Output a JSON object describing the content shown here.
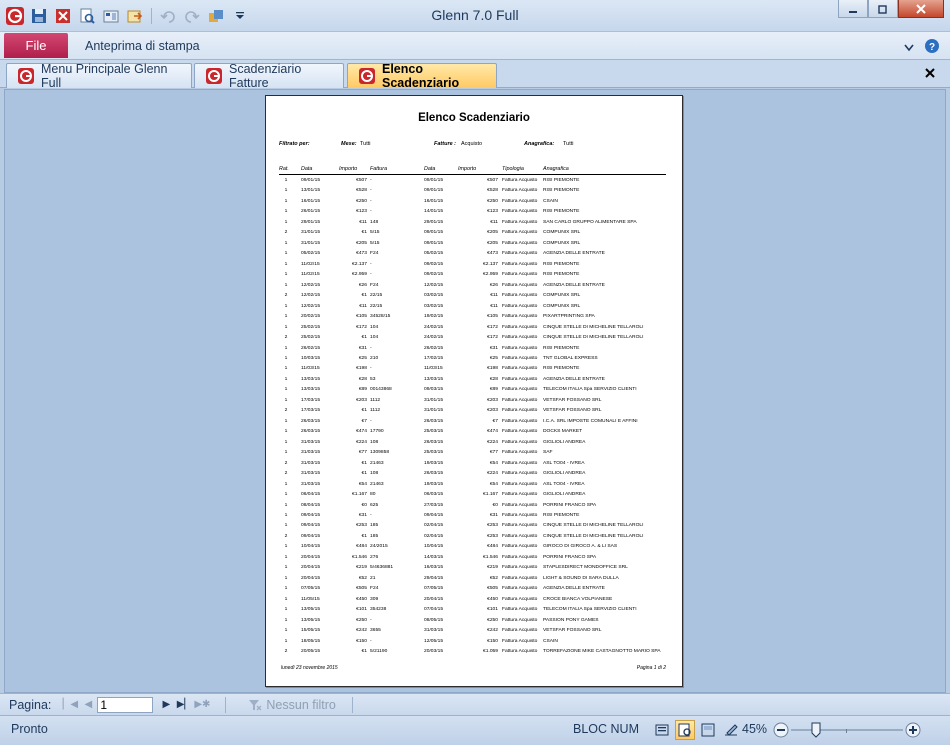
{
  "app": {
    "title": "Glenn 7.0 Full"
  },
  "ribbon": {
    "file_label": "File",
    "active_tab": "Anteprima di stampa"
  },
  "tabs": [
    {
      "label": "Menu Principale Glenn Full"
    },
    {
      "label": "Scadenziario Fatture"
    },
    {
      "label": "Elenco Scadenziario"
    }
  ],
  "report": {
    "title": "Elenco Scadenziario",
    "filters": {
      "label_filtrato": "Filtrato per:",
      "label_mese": "Mese:",
      "mese": "Tutti",
      "label_fatture": "Fatture :",
      "fatture": "Acquisto",
      "label_anagrafica": "Anagrafica:",
      "anagrafica": "Tutti"
    },
    "columns": [
      "Rat.",
      "Data",
      "Importo",
      "Fattura",
      "Data",
      "Importo",
      "Tipologia",
      "Anagrafica"
    ],
    "rows": [
      [
        "1",
        "09/01/15",
        "€507",
        "-",
        "09/01/15",
        "€507",
        "Fattura Acquisto",
        "RISI PIEMONTE"
      ],
      [
        "1",
        "13/01/15",
        "€528",
        "-",
        "09/01/15",
        "€528",
        "Fattura Acquisto",
        "RISI PIEMONTE"
      ],
      [
        "1",
        "16/01/15",
        "€250",
        "-",
        "16/01/15",
        "€250",
        "Fattura Acquisto",
        "CSAIN"
      ],
      [
        "1",
        "26/01/15",
        "€123",
        "-",
        "14/01/15",
        "€123",
        "Fattura Acquisto",
        "RISI PIEMONTE"
      ],
      [
        "1",
        "29/01/15",
        "€11",
        "148",
        "29/01/15",
        "€11",
        "Fattura Acquisto",
        "SAN CARLO GRUPPO ALIMENTARE SPA"
      ],
      [
        "2",
        "31/01/15",
        "€1",
        "5/15",
        "09/01/15",
        "€205",
        "Fattura Acquisto",
        "COMPUNIX SRL"
      ],
      [
        "1",
        "31/01/15",
        "€205",
        "5/15",
        "09/01/15",
        "€205",
        "Fattura Acquisto",
        "COMPUNIX SRL"
      ],
      [
        "1",
        "05/02/15",
        "€473",
        "F24",
        "05/02/15",
        "€473",
        "Fattura Acquisto",
        "AGENZIA DELLE ENTRATE"
      ],
      [
        "1",
        "11/02/15",
        "€2.137",
        "-",
        "09/02/15",
        "€2.137",
        "Fattura Acquisto",
        "RISI PIEMONTE"
      ],
      [
        "1",
        "11/02/15",
        "€2.959",
        "-",
        "09/02/15",
        "€2.959",
        "Fattura Acquisto",
        "RISI PIEMONTE"
      ],
      [
        "1",
        "12/02/15",
        "€26",
        "F24",
        "12/02/15",
        "€26",
        "Fattura Acquisto",
        "AGENZIA DELLE ENTRATE"
      ],
      [
        "2",
        "12/02/15",
        "€1",
        "22/15",
        "03/02/15",
        "€11",
        "Fattura Acquisto",
        "COMPUNIX SRL"
      ],
      [
        "1",
        "12/02/15",
        "€11",
        "22/15",
        "03/02/15",
        "€11",
        "Fattura Acquisto",
        "COMPUNIX SRL"
      ],
      [
        "1",
        "20/02/15",
        "€105",
        "34528/15",
        "19/02/15",
        "€105",
        "Fattura Acquisto",
        "PIXARTPRINTING SPA"
      ],
      [
        "1",
        "25/02/15",
        "€172",
        "104",
        "24/02/15",
        "€172",
        "Fattura Acquisto",
        "CINQUE STELLE DI MICHELINE TELLAROLI"
      ],
      [
        "2",
        "25/02/15",
        "€1",
        "104",
        "24/02/15",
        "€172",
        "Fattura Acquisto",
        "CINQUE STELLE DI MICHELINE TELLAROLI"
      ],
      [
        "1",
        "26/02/15",
        "€31",
        "-",
        "26/02/15",
        "€31",
        "Fattura Acquisto",
        "RISI PIEMONTE"
      ],
      [
        "1",
        "10/03/15",
        "€25",
        "210",
        "17/02/15",
        "€25",
        "Fattura Acquisto",
        "TNT GLOBAL EXPRESS"
      ],
      [
        "1",
        "11/03/15",
        "€198",
        "-",
        "11/03/15",
        "€198",
        "Fattura Acquisto",
        "RISI PIEMONTE"
      ],
      [
        "1",
        "13/03/15",
        "€28",
        "53",
        "13/03/15",
        "€28",
        "Fattura Acquisto",
        "AGENZIA DELLE ENTRATE"
      ],
      [
        "1",
        "13/03/15",
        "€89",
        "00143868",
        "09/03/15",
        "€89",
        "Fattura Acquisto",
        "TELECOM ITALIA Spa SERVIZIO CLIENTI"
      ],
      [
        "1",
        "17/03/15",
        "€203",
        "1112",
        "31/01/15",
        "€203",
        "Fattura Acquisto",
        "VETSFAR FOSSANO SRL"
      ],
      [
        "2",
        "17/03/15",
        "€1",
        "1112",
        "31/01/15",
        "€203",
        "Fattura Acquisto",
        "VETSFAR FOSSANO SRL"
      ],
      [
        "1",
        "26/03/15",
        "€7",
        "-",
        "26/03/15",
        "€7",
        "Fattura Acquisto",
        "I.C.A. SRL IMPOSTE COMUNALI E AFFINI"
      ],
      [
        "1",
        "26/03/15",
        "€474",
        "17790",
        "25/03/15",
        "€474",
        "Fattura Acquisto",
        "DOCKS MARKET"
      ],
      [
        "1",
        "31/03/15",
        "€224",
        "108",
        "26/03/15",
        "€224",
        "Fattura Acquisto",
        "GIGLIOLI ANDREA"
      ],
      [
        "1",
        "31/03/15",
        "€77",
        "1309858",
        "25/03/15",
        "€77",
        "Fattura Acquisto",
        "SAF"
      ],
      [
        "2",
        "31/03/15",
        "€1",
        "21463",
        "19/03/15",
        "€54",
        "Fattura Acquisto",
        "ASL TO04 - IVREA"
      ],
      [
        "2",
        "31/03/15",
        "€1",
        "108",
        "26/03/15",
        "€224",
        "Fattura Acquisto",
        "GIGLIOLI ANDREA"
      ],
      [
        "1",
        "31/03/15",
        "€54",
        "21463",
        "19/03/15",
        "€54",
        "Fattura Acquisto",
        "ASL TO04 - IVREA"
      ],
      [
        "1",
        "06/04/15",
        "€1.167",
        "80",
        "06/03/15",
        "€1.167",
        "Fattura Acquisto",
        "GIGLIOLI ANDREA"
      ],
      [
        "1",
        "08/04/15",
        "€0",
        "625",
        "27/03/15",
        "€0",
        "Fattura Acquisto",
        "PORRINI FRANCO SPA"
      ],
      [
        "1",
        "09/04/15",
        "€31",
        "-",
        "09/04/15",
        "€31",
        "Fattura Acquisto",
        "RISI PIEMONTE"
      ],
      [
        "1",
        "09/04/15",
        "€253",
        "185",
        "02/04/15",
        "€253",
        "Fattura Acquisto",
        "CINQUE STELLE DI MICHELINE TELLAROLI"
      ],
      [
        "2",
        "09/04/15",
        "€1",
        "185",
        "02/04/15",
        "€253",
        "Fattura Acquisto",
        "CINQUE STELLE DI MICHELINE TELLAROLI"
      ],
      [
        "1",
        "10/04/15",
        "€484",
        "24/2015",
        "10/04/15",
        "€484",
        "Fattura Acquisto",
        "GIROCO DI GIROCO A. & LI SAS"
      ],
      [
        "1",
        "20/04/15",
        "€1.546",
        "276",
        "14/03/15",
        "€1.546",
        "Fattura Acquisto",
        "PORRINI FRANCO SPA"
      ],
      [
        "1",
        "20/04/15",
        "€219",
        "5/4636881",
        "16/03/15",
        "€219",
        "Fattura Acquisto",
        "STAPLESDIRECT MONDOFFICE SRL"
      ],
      [
        "1",
        "20/04/15",
        "€52",
        "21",
        "29/04/15",
        "€52",
        "Fattura Acquisto",
        "LIGHT & SOUND DI SARA DULLA"
      ],
      [
        "1",
        "07/05/15",
        "€505",
        "F24",
        "07/05/15",
        "€505",
        "Fattura Acquisto",
        "AGENZIA DELLE ENTRATE"
      ],
      [
        "1",
        "11/05/15",
        "€450",
        "309",
        "20/04/15",
        "€450",
        "Fattura Acquisto",
        "CROCE BIANCA VOLPIANESE"
      ],
      [
        "1",
        "13/05/15",
        "€101",
        "354238",
        "07/04/15",
        "€101",
        "Fattura Acquisto",
        "TELECOM ITALIA Spa SERVIZIO CLIENTI"
      ],
      [
        "1",
        "13/05/15",
        "€250",
        "-",
        "08/05/15",
        "€250",
        "Fattura Acquisto",
        "PASSION PONY GAMES"
      ],
      [
        "1",
        "15/05/15",
        "€242",
        "3655",
        "31/03/15",
        "€242",
        "Fattura Acquisto",
        "VETSFAR FOSSANO SRL"
      ],
      [
        "1",
        "18/05/15",
        "€150",
        "-",
        "12/05/15",
        "€150",
        "Fattura Acquisto",
        "CSAIN"
      ],
      [
        "2",
        "20/05/15",
        "€1",
        "5/21190",
        "20/03/15",
        "€1.059",
        "Fattura Acquisto",
        "TORREFAZIONE MIKE CASTAGNOTTO MARIO SPA"
      ]
    ],
    "footer_date": "lunedì 23 novembre 2015",
    "footer_page": "Pagina 1 di 2"
  },
  "navbar": {
    "page_label": "Pagina:",
    "page_value": "1",
    "filter_label": "Nessun filtro"
  },
  "status": {
    "text": "Pronto",
    "numlock": "BLOC NUM",
    "zoom": "45%"
  }
}
